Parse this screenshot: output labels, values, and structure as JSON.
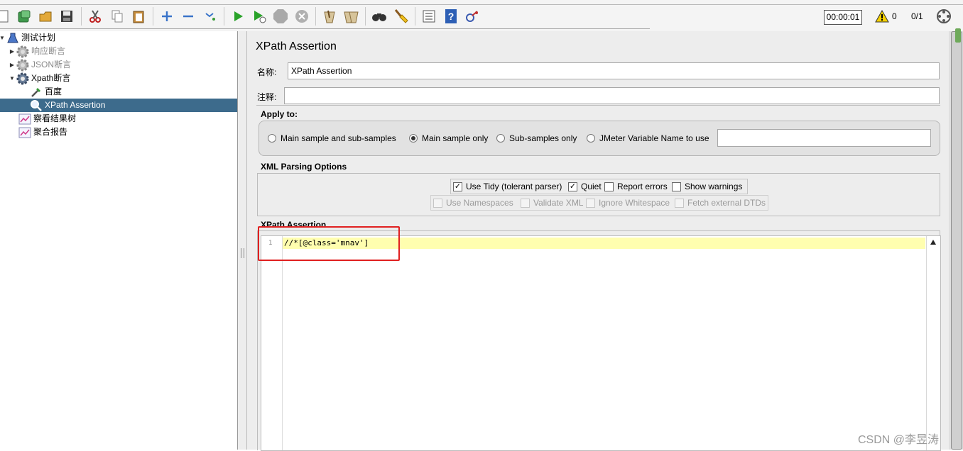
{
  "toolbar": {
    "icons": [
      "new-icon",
      "templates-icon",
      "open-icon",
      "save-icon",
      "cut-icon",
      "copy-icon",
      "paste-icon",
      "expand-icon",
      "collapse-icon",
      "toggle-icon",
      "start-icon",
      "start-no-pause-icon",
      "stop-icon",
      "shutdown-icon",
      "clear-icon",
      "clear-all-icon",
      "search-icon",
      "reset-search-icon",
      "function-helper-icon",
      "help-icon",
      "remote-icon"
    ],
    "timer": "00:00:01",
    "warning_count": "0",
    "threads": "0/1"
  },
  "tree": {
    "items": [
      {
        "label": "测试计划",
        "icon": "test-plan-icon",
        "expander": "▼",
        "state": "normal"
      },
      {
        "label": "响应断言",
        "icon": "gear-icon",
        "expander": "▶",
        "state": "disabled"
      },
      {
        "label": "JSON断言",
        "icon": "gear-icon",
        "expander": "▶",
        "state": "disabled"
      },
      {
        "label": "Xpath断言",
        "icon": "gear-icon",
        "expander": "▼",
        "state": "normal"
      },
      {
        "label": "百度",
        "icon": "sampler-pipette-icon",
        "expander": "",
        "state": "normal"
      },
      {
        "label": "XPath Assertion",
        "icon": "magnifier-icon",
        "expander": "",
        "state": "selected"
      },
      {
        "label": "察看结果树",
        "icon": "listener-graph-icon",
        "expander": "",
        "state": "normal"
      },
      {
        "label": "聚合报告",
        "icon": "listener-graph-icon",
        "expander": "",
        "state": "normal"
      }
    ]
  },
  "panel": {
    "title": "XPath Assertion",
    "name_label": "名称:",
    "name_value": "XPath Assertion",
    "comment_label": "注释:",
    "comment_value": "",
    "apply_to": {
      "title": "Apply to:",
      "options": [
        "Main sample and sub-samples",
        "Main sample only",
        "Sub-samples only",
        "JMeter Variable Name to use"
      ],
      "selected": "Main sample only",
      "variable_value": ""
    },
    "xml_parsing": {
      "title": "XML Parsing Options",
      "row1": [
        {
          "label": "Use Tidy (tolerant parser)",
          "checked": true,
          "enabled": true
        },
        {
          "label": "Quiet",
          "checked": true,
          "enabled": true
        },
        {
          "label": "Report errors",
          "checked": false,
          "enabled": true
        },
        {
          "label": "Show warnings",
          "checked": false,
          "enabled": true
        }
      ],
      "row2": [
        {
          "label": "Use Namespaces",
          "checked": false,
          "enabled": false
        },
        {
          "label": "Validate XML",
          "checked": false,
          "enabled": false
        },
        {
          "label": "Ignore Whitespace",
          "checked": false,
          "enabled": false
        },
        {
          "label": "Fetch external DTDs",
          "checked": false,
          "enabled": false
        }
      ]
    },
    "xpath": {
      "title": "XPath Assertion",
      "line_number": "1",
      "expression": "//*[@class='mnav']"
    }
  },
  "watermark": "CSDN @李昱涛",
  "colors": {
    "selection": "#3d6b8c",
    "highlight_line": "#fffeaf",
    "annotation_box": "#e02020",
    "panel_bg": "#ededed"
  }
}
